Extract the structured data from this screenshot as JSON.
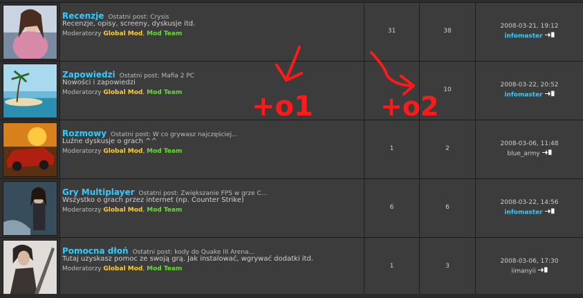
{
  "last_post_prefix": "Ostatni post:",
  "moderators_prefix": "Moderatorzy",
  "mod_global": "Global Mod",
  "mod_separator": ",",
  "mod_team": "Mod Team",
  "forums": [
    {
      "name": "Recenzje",
      "last_post": "Crysis",
      "description": "Recenzje, opisy, screeny, dyskusje itd.",
      "topics": "31",
      "posts": "38",
      "last_date": "2008-03-21, 19:12",
      "last_user": "infomaster",
      "user_highlight": true,
      "thumb_icon": "woman-portrait-thumbnail"
    },
    {
      "name": "Zapowiedzi",
      "last_post": "Mafia 2 PC",
      "description": "Nowości i zapowiedzi",
      "topics": "",
      "posts": "10",
      "last_date": "2008-03-22, 20:52",
      "last_user": "infomaster",
      "user_highlight": true,
      "thumb_icon": "tropical-beach-thumbnail"
    },
    {
      "name": "Rozmowy",
      "last_post": "W co grywasz najczęściej...",
      "description": "Luźne dyskusje o grach ^^",
      "topics": "1",
      "posts": "2",
      "last_date": "2008-03-06, 11:48",
      "last_user": "blue_army",
      "user_highlight": false,
      "thumb_icon": "race-car-thumbnail"
    },
    {
      "name": "Gry Multiplayer",
      "last_post": "Zwiększanie FPS w grze C...",
      "description": "Wszystko o grach przez internet (np. Counter Strike)",
      "topics": "6",
      "posts": "6",
      "last_date": "2008-03-22, 14:56",
      "last_user": "infomaster",
      "user_highlight": true,
      "thumb_icon": "warrior-woman-thumbnail"
    },
    {
      "name": "Pomocna dłoń",
      "last_post": "kody do Quake III Arena...",
      "description": "Tutaj uzyskasz pomoc ze swoją grą. Jak instalować, wgrywać dodatki itd.",
      "topics": "1",
      "posts": "3",
      "last_date": "2008-03-06, 17:30",
      "last_user": "iimanyii",
      "user_highlight": false,
      "thumb_icon": "swordsman-thumbnail"
    }
  ],
  "annotations": {
    "left_text": "+o1",
    "right_text": "+o2",
    "color": "#ff1a1a"
  },
  "colors": {
    "forum_link": "#33ccff",
    "global_mod": "#ffcc33",
    "mod_team": "#66dd33",
    "cell_bg": "#3c3c3c"
  }
}
